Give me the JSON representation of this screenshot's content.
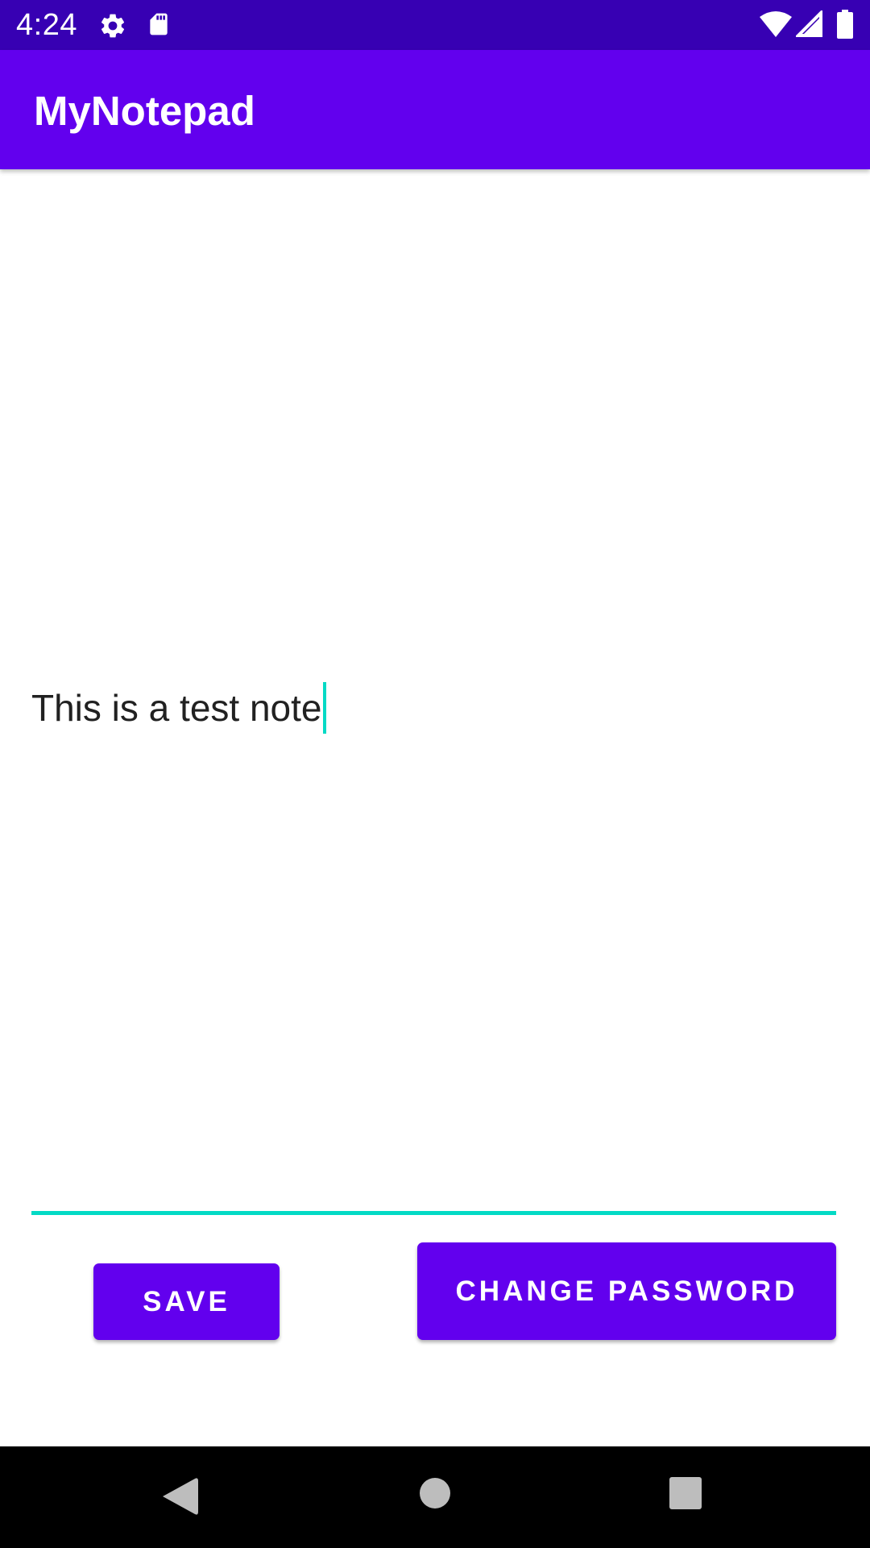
{
  "status_bar": {
    "time": "4:24",
    "background": "#3700b3",
    "icons": [
      "gear-icon",
      "sd-card-icon",
      "wifi-icon",
      "cell-signal-icon",
      "battery-icon"
    ]
  },
  "app_bar": {
    "title": "MyNotepad",
    "background": "#6200ee"
  },
  "note": {
    "value": "This is a test note",
    "accent": "#03dac5"
  },
  "buttons": {
    "save_label": "SAVE",
    "change_password_label": "CHANGE PASSWORD",
    "background": "#6200ee"
  },
  "nav_bar": {
    "icons": [
      "back-icon",
      "home-icon",
      "recents-icon"
    ]
  }
}
